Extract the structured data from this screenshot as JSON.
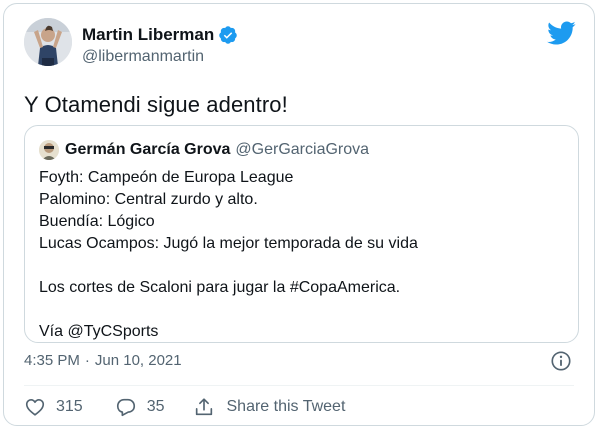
{
  "author": {
    "name": "Martin Liberman",
    "handle": "@libermanmartin",
    "verified": true
  },
  "tweet": {
    "text": "Y Otamendi sigue adentro!"
  },
  "quoted": {
    "name": "Germán García Grova",
    "handle": "@GerGarciaGrova",
    "lines": [
      "Foyth: Campeón de Europa League",
      "Palomino: Central zurdo y alto.",
      "Buendía: Lógico",
      "Lucas Ocampos: Jugó la mejor temporada de su vida",
      "",
      "Los cortes de Scaloni para jugar la #CopaAmerica.",
      "",
      "Vía @TyCSports"
    ]
  },
  "meta": {
    "time": "4:35 PM",
    "separator": "·",
    "date": "Jun 10, 2021"
  },
  "actions": {
    "likes": "315",
    "replies": "35",
    "share_label": "Share this Tweet"
  },
  "icons": {
    "brand": "twitter-bird-icon",
    "verified": "verified-badge-icon",
    "info": "info-icon",
    "like": "heart-icon",
    "reply": "reply-icon",
    "share": "share-icon"
  },
  "colors": {
    "brand": "#1d9bf0",
    "text": "#0f1419",
    "muted": "#536471",
    "border": "#cfd9de"
  }
}
